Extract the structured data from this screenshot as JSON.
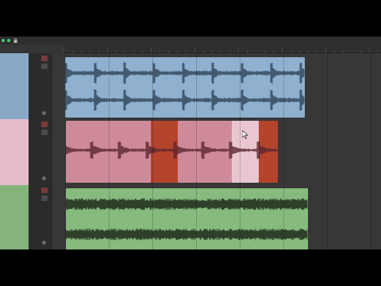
{
  "toolbar": {
    "status_color": "#3bd070",
    "lock_icon": "lock-icon"
  },
  "tracks": [
    {
      "name": "",
      "color": "#8aa9c8",
      "clip_color": "#8fb0cf"
    },
    {
      "name": "",
      "color": "#e6bccb",
      "clip_color": "#cf8a99",
      "accent_clip_color": "#b5442d"
    },
    {
      "name": "",
      "color": "#84b47a",
      "clip_color": "#86bb7d"
    }
  ],
  "cursor": {
    "icon": "mouse-pointer-icon"
  }
}
